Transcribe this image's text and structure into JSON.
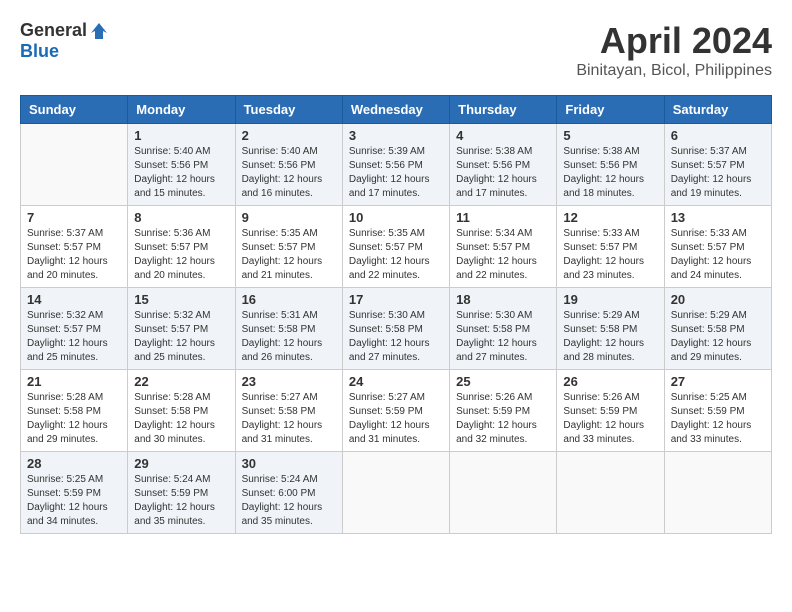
{
  "header": {
    "logo_general": "General",
    "logo_blue": "Blue",
    "month_title": "April 2024",
    "location": "Binitayan, Bicol, Philippines"
  },
  "calendar": {
    "days_of_week": [
      "Sunday",
      "Monday",
      "Tuesday",
      "Wednesday",
      "Thursday",
      "Friday",
      "Saturday"
    ],
    "weeks": [
      [
        {
          "day": "",
          "info": ""
        },
        {
          "day": "1",
          "info": "Sunrise: 5:40 AM\nSunset: 5:56 PM\nDaylight: 12 hours\nand 15 minutes."
        },
        {
          "day": "2",
          "info": "Sunrise: 5:40 AM\nSunset: 5:56 PM\nDaylight: 12 hours\nand 16 minutes."
        },
        {
          "day": "3",
          "info": "Sunrise: 5:39 AM\nSunset: 5:56 PM\nDaylight: 12 hours\nand 17 minutes."
        },
        {
          "day": "4",
          "info": "Sunrise: 5:38 AM\nSunset: 5:56 PM\nDaylight: 12 hours\nand 17 minutes."
        },
        {
          "day": "5",
          "info": "Sunrise: 5:38 AM\nSunset: 5:56 PM\nDaylight: 12 hours\nand 18 minutes."
        },
        {
          "day": "6",
          "info": "Sunrise: 5:37 AM\nSunset: 5:57 PM\nDaylight: 12 hours\nand 19 minutes."
        }
      ],
      [
        {
          "day": "7",
          "info": "Sunrise: 5:37 AM\nSunset: 5:57 PM\nDaylight: 12 hours\nand 20 minutes."
        },
        {
          "day": "8",
          "info": "Sunrise: 5:36 AM\nSunset: 5:57 PM\nDaylight: 12 hours\nand 20 minutes."
        },
        {
          "day": "9",
          "info": "Sunrise: 5:35 AM\nSunset: 5:57 PM\nDaylight: 12 hours\nand 21 minutes."
        },
        {
          "day": "10",
          "info": "Sunrise: 5:35 AM\nSunset: 5:57 PM\nDaylight: 12 hours\nand 22 minutes."
        },
        {
          "day": "11",
          "info": "Sunrise: 5:34 AM\nSunset: 5:57 PM\nDaylight: 12 hours\nand 22 minutes."
        },
        {
          "day": "12",
          "info": "Sunrise: 5:33 AM\nSunset: 5:57 PM\nDaylight: 12 hours\nand 23 minutes."
        },
        {
          "day": "13",
          "info": "Sunrise: 5:33 AM\nSunset: 5:57 PM\nDaylight: 12 hours\nand 24 minutes."
        }
      ],
      [
        {
          "day": "14",
          "info": "Sunrise: 5:32 AM\nSunset: 5:57 PM\nDaylight: 12 hours\nand 25 minutes."
        },
        {
          "day": "15",
          "info": "Sunrise: 5:32 AM\nSunset: 5:57 PM\nDaylight: 12 hours\nand 25 minutes."
        },
        {
          "day": "16",
          "info": "Sunrise: 5:31 AM\nSunset: 5:58 PM\nDaylight: 12 hours\nand 26 minutes."
        },
        {
          "day": "17",
          "info": "Sunrise: 5:30 AM\nSunset: 5:58 PM\nDaylight: 12 hours\nand 27 minutes."
        },
        {
          "day": "18",
          "info": "Sunrise: 5:30 AM\nSunset: 5:58 PM\nDaylight: 12 hours\nand 27 minutes."
        },
        {
          "day": "19",
          "info": "Sunrise: 5:29 AM\nSunset: 5:58 PM\nDaylight: 12 hours\nand 28 minutes."
        },
        {
          "day": "20",
          "info": "Sunrise: 5:29 AM\nSunset: 5:58 PM\nDaylight: 12 hours\nand 29 minutes."
        }
      ],
      [
        {
          "day": "21",
          "info": "Sunrise: 5:28 AM\nSunset: 5:58 PM\nDaylight: 12 hours\nand 29 minutes."
        },
        {
          "day": "22",
          "info": "Sunrise: 5:28 AM\nSunset: 5:58 PM\nDaylight: 12 hours\nand 30 minutes."
        },
        {
          "day": "23",
          "info": "Sunrise: 5:27 AM\nSunset: 5:58 PM\nDaylight: 12 hours\nand 31 minutes."
        },
        {
          "day": "24",
          "info": "Sunrise: 5:27 AM\nSunset: 5:59 PM\nDaylight: 12 hours\nand 31 minutes."
        },
        {
          "day": "25",
          "info": "Sunrise: 5:26 AM\nSunset: 5:59 PM\nDaylight: 12 hours\nand 32 minutes."
        },
        {
          "day": "26",
          "info": "Sunrise: 5:26 AM\nSunset: 5:59 PM\nDaylight: 12 hours\nand 33 minutes."
        },
        {
          "day": "27",
          "info": "Sunrise: 5:25 AM\nSunset: 5:59 PM\nDaylight: 12 hours\nand 33 minutes."
        }
      ],
      [
        {
          "day": "28",
          "info": "Sunrise: 5:25 AM\nSunset: 5:59 PM\nDaylight: 12 hours\nand 34 minutes."
        },
        {
          "day": "29",
          "info": "Sunrise: 5:24 AM\nSunset: 5:59 PM\nDaylight: 12 hours\nand 35 minutes."
        },
        {
          "day": "30",
          "info": "Sunrise: 5:24 AM\nSunset: 6:00 PM\nDaylight: 12 hours\nand 35 minutes."
        },
        {
          "day": "",
          "info": ""
        },
        {
          "day": "",
          "info": ""
        },
        {
          "day": "",
          "info": ""
        },
        {
          "day": "",
          "info": ""
        }
      ]
    ]
  }
}
